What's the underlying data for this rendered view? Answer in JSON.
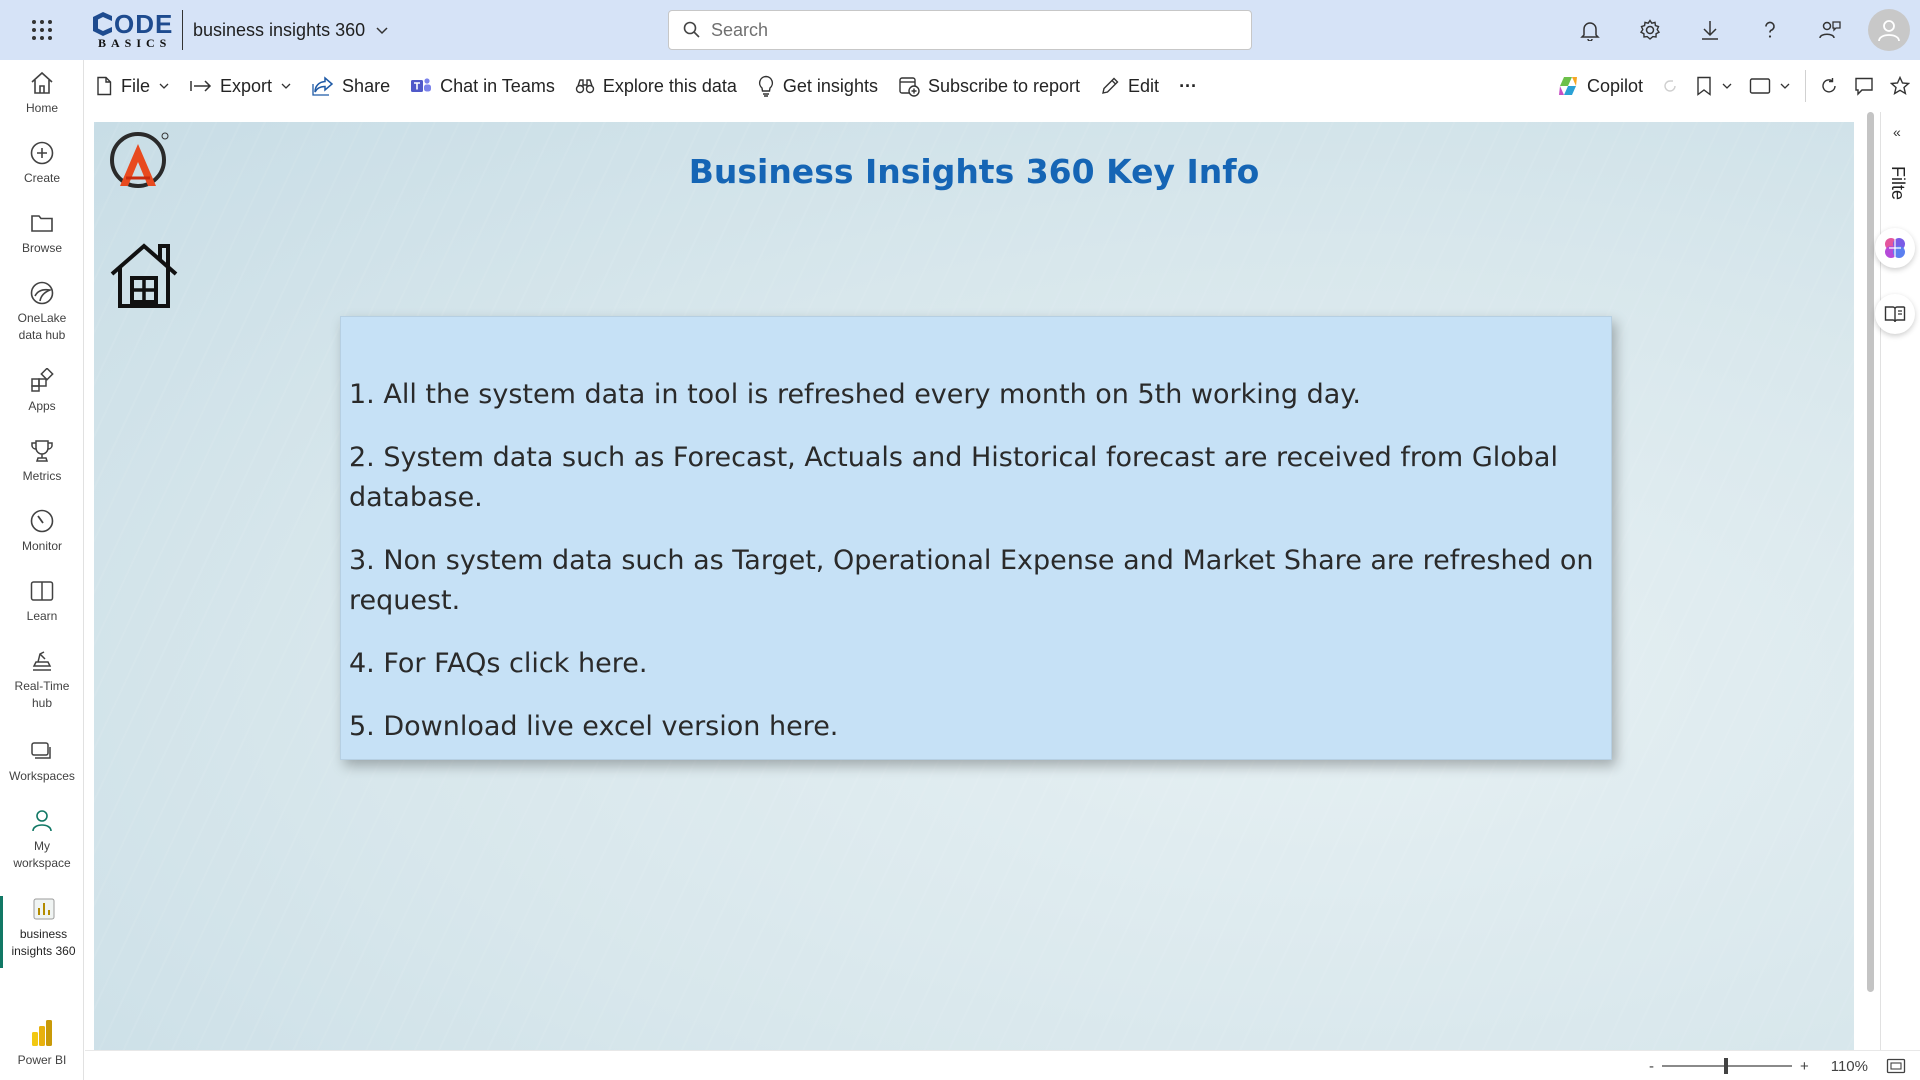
{
  "topbar": {
    "brand_line1": "ODE",
    "brand_line2": "BASICS",
    "report_name": "business insights 360",
    "search_placeholder": "Search"
  },
  "leftnav": [
    {
      "label": "Home",
      "icon": "home-icon"
    },
    {
      "label": "Create",
      "icon": "plus-circle-icon"
    },
    {
      "label": "Browse",
      "icon": "folder-icon"
    },
    {
      "label": "OneLake data hub",
      "icon": "onelake-icon"
    },
    {
      "label": "Apps",
      "icon": "apps-icon"
    },
    {
      "label": "Metrics",
      "icon": "trophy-icon"
    },
    {
      "label": "Monitor",
      "icon": "monitor-icon"
    },
    {
      "label": "Learn",
      "icon": "book-icon"
    },
    {
      "label": "Real-Time hub",
      "icon": "realtime-icon"
    },
    {
      "label": "Workspaces",
      "icon": "workspaces-icon"
    },
    {
      "label": "My workspace",
      "icon": "person-icon"
    },
    {
      "label": "business insights 360",
      "icon": "report-icon"
    },
    {
      "label": "Power BI",
      "icon": "powerbi-icon"
    }
  ],
  "actionbar": {
    "file": "File",
    "export": "Export",
    "share": "Share",
    "chat_in_teams": "Chat in Teams",
    "explore": "Explore this data",
    "get_insights": "Get insights",
    "subscribe": "Subscribe to report",
    "edit": "Edit",
    "more": "···",
    "copilot": "Copilot"
  },
  "report": {
    "title": "Business Insights 360 Key Info",
    "info_lines": [
      "1. All the system data in tool is refreshed every month on 5th working day.",
      "2.  System data such as Forecast, Actuals and Historical forecast are received from Global database.",
      "3.  Non system data such as Target, Operational Expense and Market Share are refreshed on request.",
      "4. For FAQs click here.",
      "5. Download live excel version here."
    ]
  },
  "rightpane": {
    "filters_label": "Filte"
  },
  "statusbar": {
    "zoom_minus": "-",
    "zoom_plus": "+",
    "zoom_level": "110%",
    "zoom_fraction": 0.5
  },
  "colors": {
    "topbar_bg": "#d6e3f7",
    "title_blue": "#1565b5",
    "card_bg": "#c6e1f6",
    "active_nav": "#117865"
  }
}
